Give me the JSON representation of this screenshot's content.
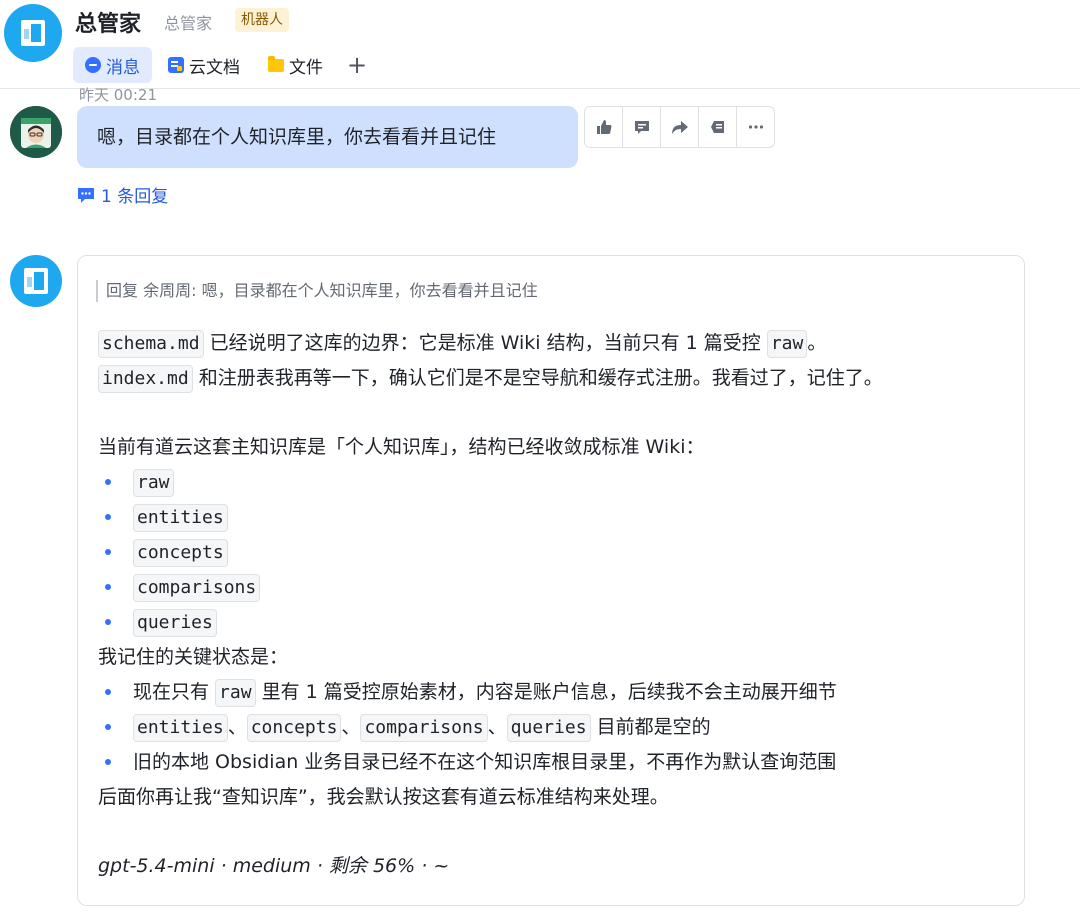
{
  "header": {
    "title": "总管家",
    "subtitle": "总管家",
    "badge": "机器人",
    "tabs": [
      {
        "label": "消息",
        "icon": "message-icon",
        "active": true
      },
      {
        "label": "云文档",
        "icon": "cloud-doc-icon",
        "active": false
      },
      {
        "label": "文件",
        "icon": "folder-icon",
        "active": false
      }
    ],
    "add_tab": "+"
  },
  "message": {
    "timestamp": "昨天 00:21",
    "text": "嗯，目录都在个人知识库里，你去看看并且记住",
    "reply_count": "1 条回复",
    "actions": [
      "thumbs-up-icon",
      "comment-icon",
      "forward-icon",
      "pin-icon",
      "more-icon"
    ]
  },
  "reply": {
    "quote": "回复 余周周: 嗯，目录都在个人知识库里，你去看看并且记住",
    "p1": {
      "code1": "schema.md",
      "text1": " 已经说明了这库的边界：它是标准 Wiki 结构，当前只有 1 篇受控 ",
      "code2": "raw",
      "text2": "。"
    },
    "p2": {
      "code1": "index.md",
      "text1": " 和注册表我再等一下，确认它们是不是空导航和缓存式注册。我看过了，记住了。"
    },
    "structure_intro": "当前有道云这套主知识库是「个人知识库」，结构已经收敛成标准 Wiki：",
    "structure_items": [
      "raw",
      "entities",
      "concepts",
      "comparisons",
      "queries"
    ],
    "state_intro": "我记住的关键状态是：",
    "state1": {
      "text1": "现在只有 ",
      "code": "raw",
      "text2": " 里有 1 篇受控原始素材，内容是账户信息，后续我不会主动展开细节"
    },
    "state2": {
      "codes": [
        "entities",
        "concepts",
        "comparisons",
        "queries"
      ],
      "sep": "、",
      "text": " 目前都是空的"
    },
    "state3": "旧的本地 Obsidian 业务目录已经不在这个知识库根目录里，不再作为默认查询范围",
    "closing": "后面你再让我“查知识库”，我会默认按这套有道云标准结构来处理。",
    "footer": "gpt-5.4-mini · medium · 剩余 56% · ~"
  }
}
